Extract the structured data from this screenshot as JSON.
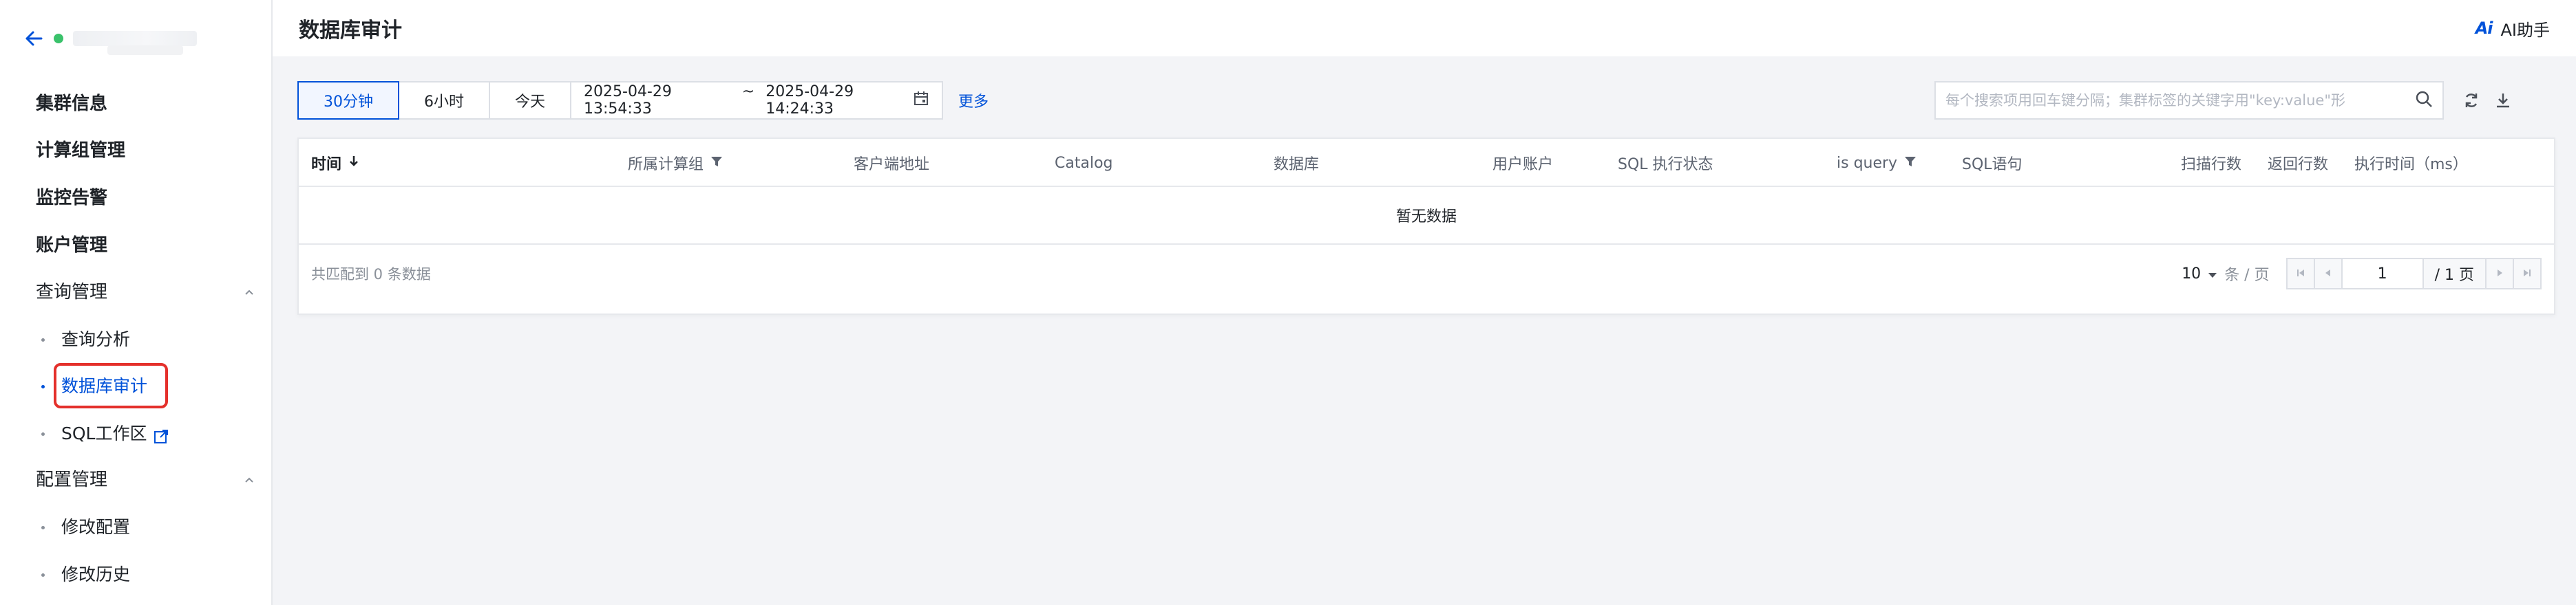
{
  "sidebar": {
    "items": [
      {
        "label": "集群信息"
      },
      {
        "label": "计算组管理"
      },
      {
        "label": "监控告警"
      },
      {
        "label": "账户管理"
      }
    ],
    "groups": [
      {
        "label": "查询管理",
        "children": [
          {
            "label": "查询分析"
          },
          {
            "label": "数据库审计"
          },
          {
            "label": "SQL工作区"
          }
        ]
      },
      {
        "label": "配置管理",
        "children": [
          {
            "label": "修改配置"
          },
          {
            "label": "修改历史"
          }
        ]
      }
    ],
    "active_item": "数据库审计",
    "status_color": "#3ac26b"
  },
  "header": {
    "title": "数据库审计",
    "ai_logo": "Ai",
    "ai_label": "AI助手"
  },
  "filters": {
    "ranges": [
      "30分钟",
      "6小时",
      "今天"
    ],
    "active_range": "30分钟",
    "date_start": "2025-04-29 13:54:33",
    "date_sep": "~",
    "date_end": "2025-04-29 14:24:33",
    "more": "更多",
    "search_placeholder": "每个搜索项用回车键分隔；集群标签的关键字用\"key:value\"形"
  },
  "table": {
    "columns": [
      "时间",
      "所属计算组",
      "客户端地址",
      "Catalog",
      "数据库",
      "用户账户",
      "SQL 执行状态",
      "is query",
      "SQL语句",
      "扫描行数",
      "返回行数",
      "执行时间（ms）"
    ],
    "empty_text": "暂无数据",
    "total_text": "共匹配到 0 条数据",
    "page_size": "10",
    "page_size_unit": "条 / 页",
    "current_page": "1",
    "total_pages": "/ 1 页"
  },
  "colors": {
    "accent": "#0052d9",
    "highlight_box": "#e4302b"
  }
}
